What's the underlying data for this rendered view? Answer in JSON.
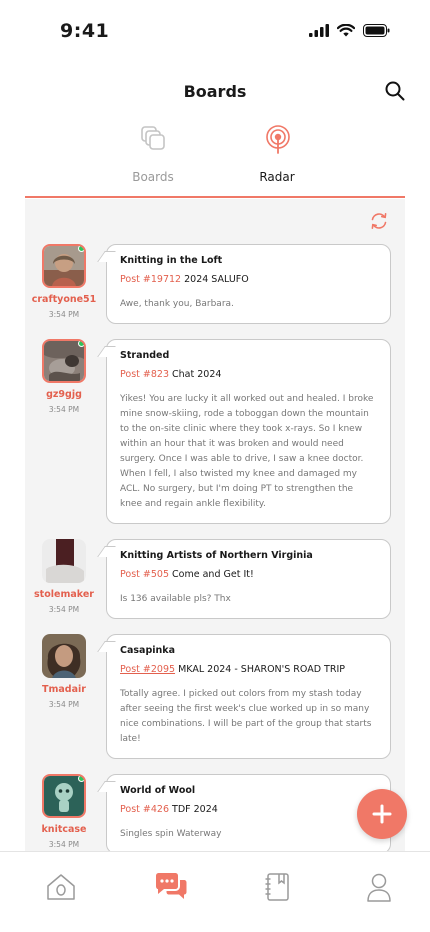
{
  "status_bar": {
    "time": "9:41"
  },
  "header": {
    "title": "Boards"
  },
  "tabs": [
    {
      "label": "Boards",
      "active": false
    },
    {
      "label": "Radar",
      "active": true
    }
  ],
  "colors": {
    "accent": "#f07867",
    "online": "#2ec45c",
    "text_muted": "#777777"
  },
  "feed": [
    {
      "username": "craftyone51",
      "time": "3:54 PM",
      "online": true,
      "board": "Knitting in the Loft",
      "post_number": "Post #19712",
      "post_title": "2024 SALUFO",
      "body": "Awe, thank you, Barbara."
    },
    {
      "username": "gz9gjg",
      "time": "3:54 PM",
      "online": true,
      "board": "Stranded",
      "post_number": "Post #823",
      "post_title": "Chat 2024",
      "body": "Yikes! You are lucky it all worked out and healed. I broke mine snow-skiing, rode a toboggan down the mountain to the on-site clinic where they took x-rays. So I knew within an hour that it was broken and would need surgery. Once I was able to drive, I saw a knee doctor. When I fell, I also twisted my knee and damaged my ACL. No surgery, but I'm doing PT to strengthen the knee and regain ankle flexibility."
    },
    {
      "username": "stolemaker",
      "time": "3:54 PM",
      "online": false,
      "board": "Knitting Artists of Northern Virginia",
      "post_number": "Post #505",
      "post_title": "Come and Get It!",
      "body": "Is 136 available pls? Thx"
    },
    {
      "username": "Tmadair",
      "time": "3:54 PM",
      "online": false,
      "board": "Casapinka",
      "post_number": "Post #2095",
      "post_title": "MKAL 2024 - SHARON'S ROAD TRIP",
      "body": "Totally agree. I picked out colors from my stash today after seeing the first week's clue worked up in so many nice combinations. I will be part of the group that starts late!"
    },
    {
      "username": "knitcase",
      "time": "3:54 PM",
      "online": true,
      "board": "World of Wool",
      "post_number": "Post #426",
      "post_title": "TDF 2024",
      "body": "Singles spin Waterway"
    }
  ],
  "icons": {
    "search": "search-icon",
    "boards_tab": "stacked-squares-icon",
    "radar_tab": "radar-icon",
    "refresh": "refresh-icon",
    "add": "plus-icon",
    "nav": [
      "home-icon",
      "chat-icon",
      "notebook-icon",
      "profile-icon"
    ]
  }
}
